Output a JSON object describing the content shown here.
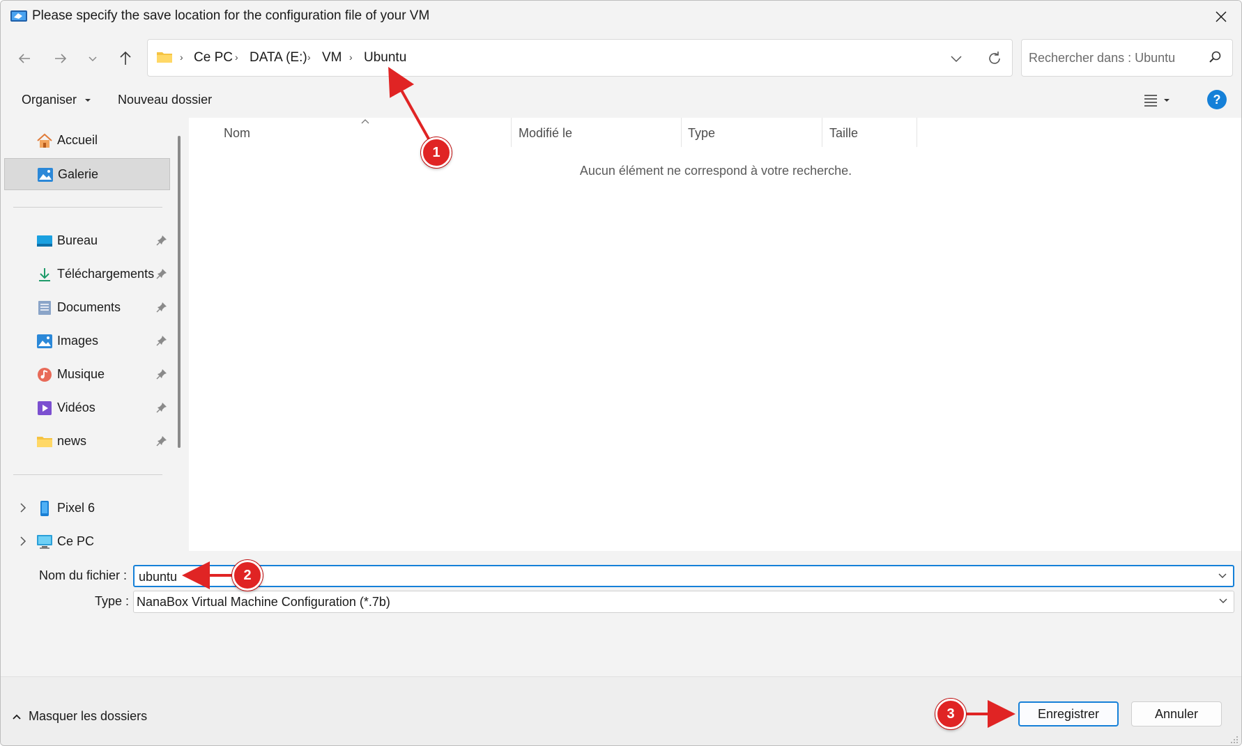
{
  "window": {
    "title": "Please specify the save location for the configuration file of your VM"
  },
  "address": {
    "crumbs": [
      "Ce PC",
      "DATA (E:)",
      "VM",
      "Ubuntu"
    ]
  },
  "search": {
    "placeholder": "Rechercher dans : Ubuntu"
  },
  "commands": {
    "organize": "Organiser",
    "new_folder": "Nouveau dossier"
  },
  "sidebar": {
    "items": [
      {
        "label": "Accueil",
        "icon": "home-icon"
      },
      {
        "label": "Galerie",
        "icon": "gallery-icon",
        "selected": true
      },
      {
        "label": "Bureau",
        "icon": "desktop-icon",
        "pinned": true
      },
      {
        "label": "Téléchargements",
        "icon": "download-icon",
        "pinned": true
      },
      {
        "label": "Documents",
        "icon": "documents-icon",
        "pinned": true
      },
      {
        "label": "Images",
        "icon": "images-icon",
        "pinned": true
      },
      {
        "label": "Musique",
        "icon": "music-icon",
        "pinned": true
      },
      {
        "label": "Vidéos",
        "icon": "videos-icon",
        "pinned": true
      },
      {
        "label": "news",
        "icon": "folder-icon",
        "pinned": true
      },
      {
        "label": "Pixel 6",
        "icon": "phone-icon",
        "expandable": true
      },
      {
        "label": "Ce PC",
        "icon": "computer-icon",
        "expandable": true
      }
    ]
  },
  "columns": [
    "Nom",
    "Modifié le",
    "Type",
    "Taille"
  ],
  "empty_message": "Aucun élément ne correspond à votre recherche.",
  "form": {
    "filename_label": "Nom du fichier :",
    "filename_value": "ubuntu",
    "type_label": "Type :",
    "type_value": "NanaBox Virtual Machine Configuration (*.7b)"
  },
  "footer": {
    "hide_folders": "Masquer les dossiers",
    "save": "Enregistrer",
    "cancel": "Annuler"
  },
  "annotations": [
    "1",
    "2",
    "3"
  ],
  "colors": {
    "accent": "#1580d8",
    "annotation": "#e02424",
    "background": "#f3f3f3"
  }
}
